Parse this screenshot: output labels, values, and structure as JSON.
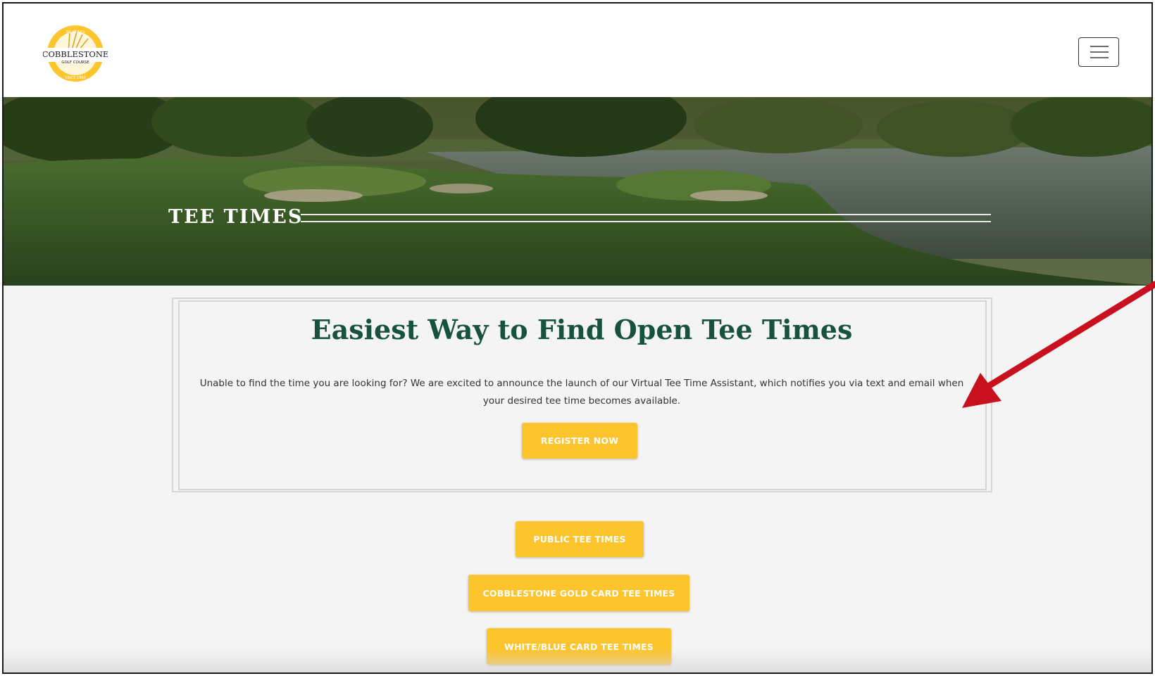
{
  "header": {
    "logo": {
      "brand": "COBBLESTONE",
      "sub": "GOLF COURSE",
      "years": "30 YEARS",
      "since": "SINCE 1993"
    },
    "menu_icon": "hamburger-menu-icon"
  },
  "hero": {
    "title": "TEE TIMES"
  },
  "promo": {
    "title": "Easiest Way to Find Open Tee Times",
    "text": "Unable to find the time you are looking for? We are excited to announce the launch of our Virtual Tee Time Assistant, which notifies you via text and email when your desired tee time becomes available.",
    "register_label": "REGISTER NOW"
  },
  "buttons": {
    "public": "PUBLIC TEE TIMES",
    "gold_card": "COBBLESTONE GOLD CARD TEE TIMES",
    "white_blue": "WHITE/BLUE CARD TEE TIMES"
  },
  "colors": {
    "accent_yellow": "#fcc42d",
    "heading_green": "#17513f",
    "annotation_red": "#c8101e"
  }
}
